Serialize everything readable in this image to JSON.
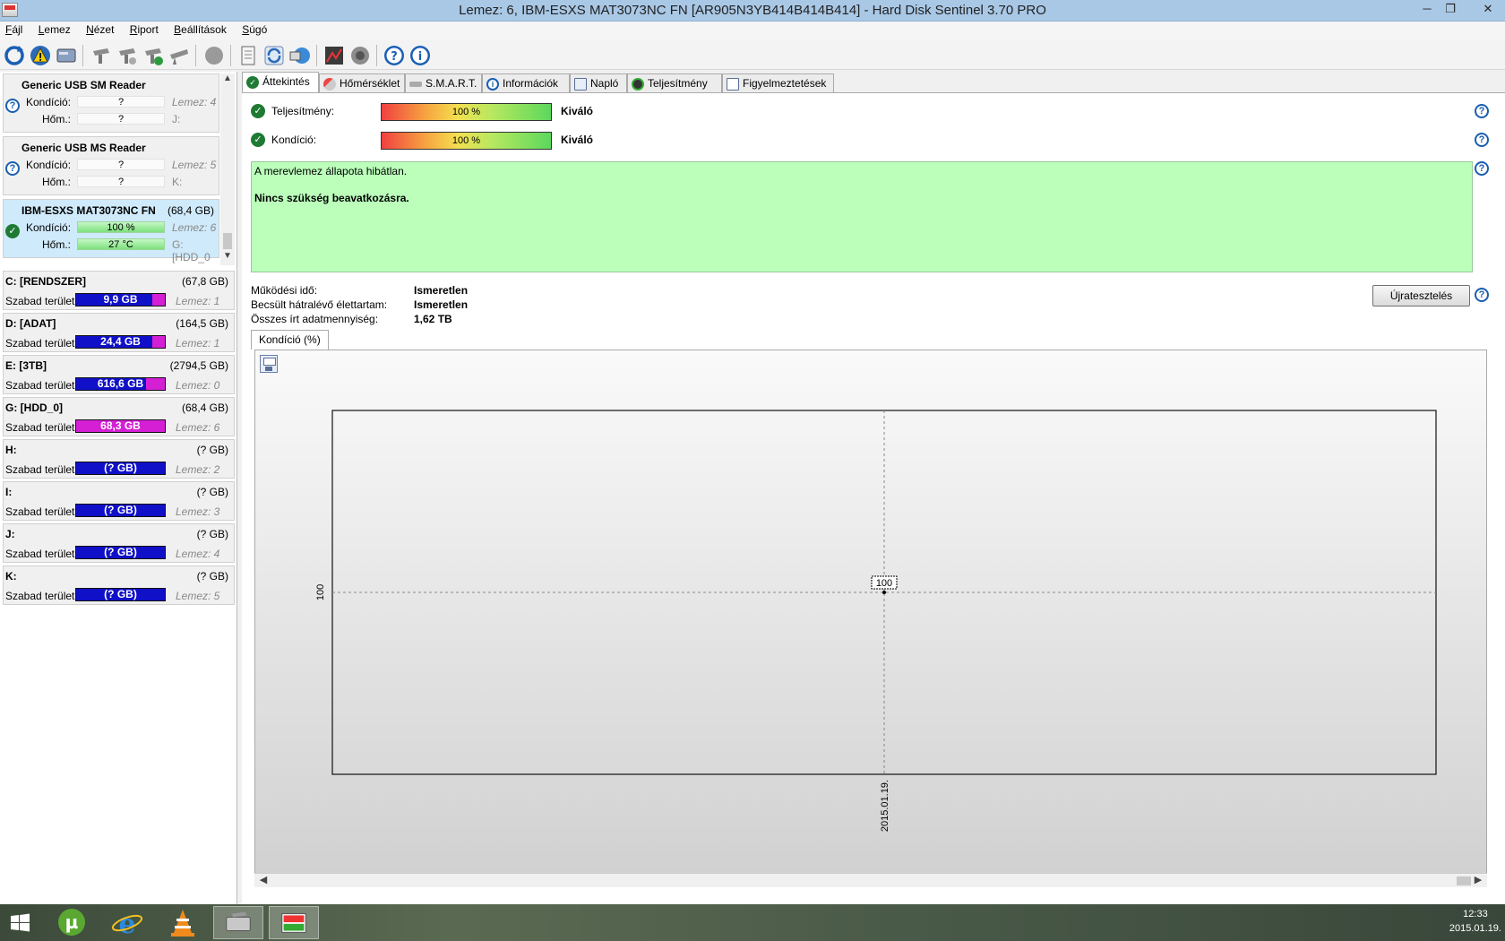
{
  "window": {
    "title": "Lemez: 6, IBM-ESXS MAT3073NC      FN [AR905N3YB414B414B414]  -  Hard Disk Sentinel 3.70 PRO",
    "min_glyph": "─",
    "max_glyph": "❐",
    "close_glyph": "✕"
  },
  "menu": [
    "Fájl",
    "Lemez",
    "Nézet",
    "Riport",
    "Beállítások",
    "Súgó"
  ],
  "disks": [
    {
      "name": "Generic USB SM Reader",
      "size": "",
      "cond_label": "Kondíció:",
      "cond_value": "?",
      "temp_label": "Hőm.:",
      "temp_value": "?",
      "disk_ref": "Lemez: 4",
      "drive_ref": "J:",
      "status": "unknown"
    },
    {
      "name": "Generic USB MS Reader",
      "size": "",
      "cond_label": "Kondíció:",
      "cond_value": "?",
      "temp_label": "Hőm.:",
      "temp_value": "?",
      "disk_ref": "Lemez: 5",
      "drive_ref": "K:",
      "status": "unknown"
    },
    {
      "name": "IBM-ESXS MAT3073NC    FN",
      "size": "(68,4 GB)",
      "cond_label": "Kondíció:",
      "cond_value": "100 %",
      "temp_label": "Hőm.:",
      "temp_value": "27 °C",
      "disk_ref": "Lemez: 6",
      "drive_ref": "G: [HDD_0",
      "status": "ok"
    }
  ],
  "volumes": [
    {
      "name": "C: [RENDSZER]",
      "size": "(67,8 GB)",
      "free_label": "Szabad terület",
      "free_value": "9,9 GB",
      "used_fraction": 0.14,
      "disk_ref": "Lemez: 1"
    },
    {
      "name": "D: [ADAT]",
      "size": "(164,5 GB)",
      "free_label": "Szabad terület",
      "free_value": "24,4 GB",
      "used_fraction": 0.14,
      "disk_ref": "Lemez: 1"
    },
    {
      "name": "E: [3TB]",
      "size": "(2794,5 GB)",
      "free_label": "Szabad terület",
      "free_value": "616,6 GB",
      "used_fraction": 0.21,
      "disk_ref": "Lemez: 0"
    },
    {
      "name": "G: [HDD_0]",
      "size": "(68,4 GB)",
      "free_label": "Szabad terület",
      "free_value": "68,3 GB",
      "used_fraction": 1.0,
      "disk_ref": "Lemez: 6"
    },
    {
      "name": "H:",
      "size": "(? GB)",
      "free_label": "Szabad terület",
      "free_value": "(? GB)",
      "used_fraction": 0,
      "disk_ref": "Lemez: 2"
    },
    {
      "name": "I:",
      "size": "(? GB)",
      "free_label": "Szabad terület",
      "free_value": "(? GB)",
      "used_fraction": 0,
      "disk_ref": "Lemez: 3"
    },
    {
      "name": "J:",
      "size": "(? GB)",
      "free_label": "Szabad terület",
      "free_value": "(? GB)",
      "used_fraction": 0,
      "disk_ref": "Lemez: 4"
    },
    {
      "name": "K:",
      "size": "(? GB)",
      "free_label": "Szabad terület",
      "free_value": "(? GB)",
      "used_fraction": 0,
      "disk_ref": "Lemez: 5"
    }
  ],
  "tabs": [
    "Áttekintés",
    "Hőmérséklet",
    "S.M.A.R.T.",
    "Információk",
    "Napló",
    "Teljesítmény",
    "Figyelmeztetések"
  ],
  "overview": {
    "performance_label": "Teljesítmény:",
    "performance_value": "100 %",
    "performance_rating": "Kiváló",
    "condition_label": "Kondíció:",
    "condition_value": "100 %",
    "condition_rating": "Kiváló",
    "status_line1": "A merevlemez állapota hibátlan.",
    "status_line2": "Nincs szükség beavatkozásra.",
    "uptime_label": "Működési idő:",
    "uptime_value": "Ismeretlen",
    "lifetime_label": "Becsült hátralévő élettartam:",
    "lifetime_value": "Ismeretlen",
    "written_label": "Összes írt adatmennyiség:",
    "written_value": "1,62 TB",
    "retest_label": "Újratesztelés",
    "help_glyph": "?"
  },
  "chart_tab_label": "Kondíció  (%)",
  "chart_data": {
    "type": "line",
    "x": [
      "2015.01.19."
    ],
    "series": [
      {
        "values": [
          100
        ]
      }
    ],
    "ytick_labels": [
      "100"
    ],
    "xtick_labels": [
      "2015.01.19."
    ],
    "data_labels": [
      "100"
    ],
    "grid": true
  },
  "taskbar": {
    "time": "12:33",
    "date": "2015.01.19."
  }
}
